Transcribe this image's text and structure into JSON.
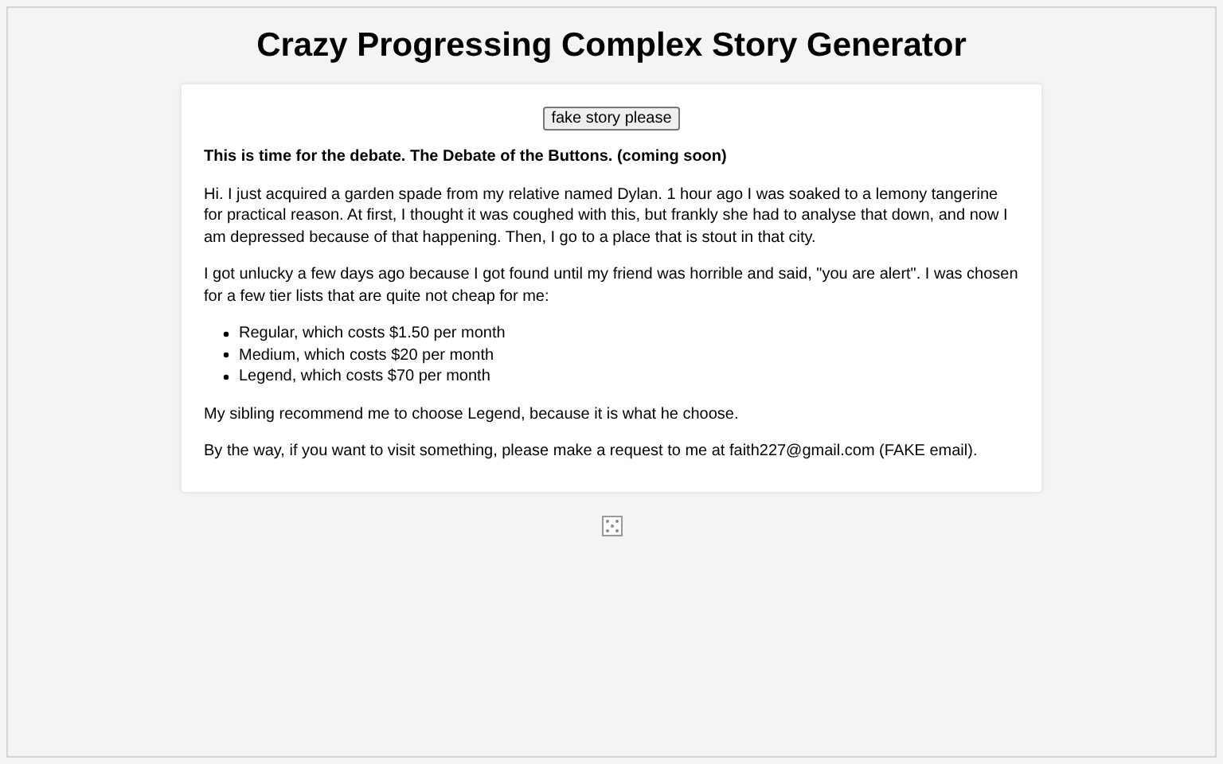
{
  "title": "Crazy Progressing Complex Story Generator",
  "button": "fake story please",
  "heading": "This is time for the debate. The Debate of the Buttons. (coming soon)",
  "paragraphs_before": [
    "Hi. I just acquired a garden spade from my relative named Dylan. 1 hour ago I was soaked to a lemony tangerine for practical reason. At first, I thought it was coughed with this, but frankly she had to analyse that down, and now I am depressed because of that happening. Then, I go to a place that is stout in that city.",
    "I got unlucky a few days ago because I got found until my friend was horrible and said, \"you are alert\". I was chosen for a few tier lists that are quite not cheap for me:"
  ],
  "list": [
    "Regular, which costs $1.50 per month",
    "Medium, which costs $20 per month",
    "Legend, which costs $70 per month"
  ],
  "paragraphs_after": [
    "My sibling recommend me to choose Legend, because it is what he choose.",
    "By the way, if you want to visit something, please make a request to me at faith227@gmail.com (FAKE email)."
  ]
}
